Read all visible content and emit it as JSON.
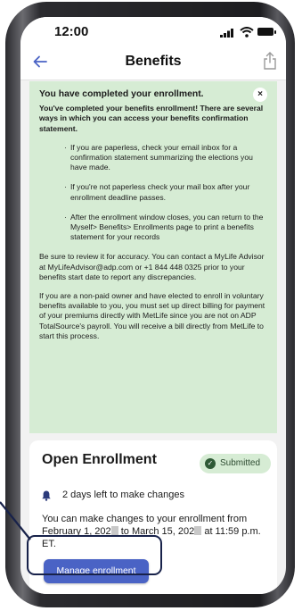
{
  "status_bar": {
    "time": "12:00"
  },
  "nav": {
    "title": "Benefits",
    "back_icon": "arrow-left-icon",
    "share_icon": "share-icon"
  },
  "alert": {
    "title": "You have completed your enrollment.",
    "subtitle": "You've completed your benefits enrollment! There are several ways in which you can access your benefits confirmation statement.",
    "bullets": [
      "If you are paperless, check your email inbox for a confirmation statement summarizing the elections you have made.",
      "If you're not paperless check your mail box after your enrollment deadline passes.",
      "After the enrollment window closes, you can return to the Myself> Benefits> Enrollments page to print a benefits statement for your records"
    ],
    "paragraph_1": "Be sure to review it for accuracy. You can contact a MyLife Advisor at MyLifeAdvisor@adp.com or +1 844 448 0325 prior to your benefits start date to report any discrepancies.",
    "paragraph_2": "If you are a non-paid owner and have elected to enroll in voluntary benefits available to you, you must set up direct billing for payment of your premiums directly with MetLife since you are not on ADP TotalSource's payroll. You will receive a bill directly from MetLife to start this process.",
    "close_label": "×"
  },
  "card": {
    "title": "Open Enrollment",
    "status_badge": "Submitted",
    "days_left": "2 days left to make changes",
    "description_part1": "You can make changes to your enrollment from February 1, 202",
    "description_part2": " to March 15, 202",
    "description_part3": " at 11:59 p.m. ET.",
    "button_label": "Manage enrollment"
  },
  "colors": {
    "alert_bg": "#d6ecd4",
    "accent": "#4a63c5",
    "badge_bg": "#d6ecd4",
    "highlight_border": "#18224a"
  }
}
